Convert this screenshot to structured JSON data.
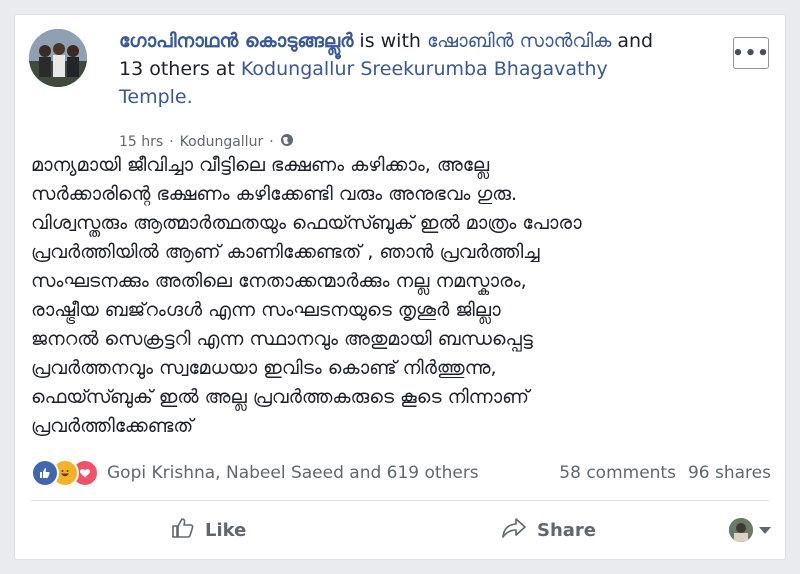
{
  "post": {
    "author": "ഗോപിനാഥൻ കൊടുങ്ങല്ലൂർ",
    "is_with": " is with ",
    "tagged_person": "ഷോബിൻ സാൻവിക",
    "and_others": " and 13 others",
    "at": " at ",
    "place": "Kodungallur Sreekurumba Bhagavathy Temple.",
    "time": "15 hrs",
    "separator": "·",
    "location": "Kodungallur",
    "body_lines": [
      "മാന്യമായി ജീവിച്ചാ വീട്ടിലെ ഭക്ഷണം കഴിക്കാം, അല്ലേ",
      "സർക്കാരിന്റെ ഭക്ഷണം കഴിക്കേണ്ടി വരും അനുഭവം ഗുരു.",
      "വിശ്വസ്തരും ആത്മാർത്ഥതയും ഫെയ്സ്ബുക് ഇൽ മാത്രം പോരാ",
      "പ്രവർത്തിയിൽ ആണ് കാണിക്കേണ്ടത് , ഞാൻ പ്രവർത്തിച്ച",
      "സംഘടനക്കും അതിലെ നേതാക്കന്മാർക്കും നല്ല നമസ്കാരം,",
      "രാഷ്ട്രീയ ബജ്‌റംഗ്ദൾ എന്ന സംഘടനയുടെ തൃശൂർ ജില്ലാ",
      "ജനറൽ സെക്രട്ടറി എന്ന സ്ഥാനവും അതുമായി ബന്ധപ്പെട്ട",
      "പ്രവർത്തനവും സ്വമേധയാ ഇവിടം കൊണ്ട് നിർത്തുന്നു,",
      "ഫെയ്സ്ബുക് ഇൽ അല്ല പ്രവർത്തകരുടെ കൂടെ നിന്നാണ്",
      "പ്രവർത്തിക്കേണ്ടത്"
    ],
    "reactions_text": "Gopi Krishna, Nabeel Saeed and 619 others",
    "comments": "58 comments",
    "shares": "96 shares",
    "like_label": "Like",
    "share_label": "Share",
    "more_label": "•••"
  },
  "icons": {
    "globe": "globe-icon",
    "like": "thumbs-up-icon",
    "share": "share-arrow-icon"
  },
  "colors": {
    "link": "#385898",
    "like_reaction": "#4267b2",
    "haha_reaction": "#f7b125",
    "love_reaction": "#f25268"
  }
}
